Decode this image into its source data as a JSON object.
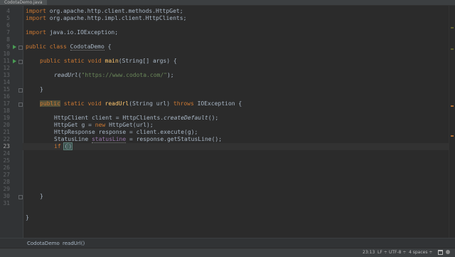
{
  "tab": {
    "title": "CodotaDemo.java"
  },
  "gutter": {
    "line_numbers": [
      "4",
      "5",
      "6",
      "7",
      "8",
      "9",
      "10",
      "11",
      "12",
      "13",
      "14",
      "15",
      "16",
      "17",
      "18",
      "19",
      "20",
      "21",
      "22",
      "23",
      "24",
      "25",
      "26",
      "27",
      "28",
      "29",
      "30",
      "31"
    ],
    "active_line": "23"
  },
  "code": {
    "l4_kw": "import",
    "l4_rest": " org.apache.http.client.methods.HttpGet;",
    "l5_kw": "import",
    "l5_rest": " org.apache.http.impl.client.HttpClients;",
    "l7_kw": "import",
    "l7_rest": " java.io.IOException;",
    "l9_kw": "public class",
    "l9_sp": " ",
    "l9_name": "CodotaDemo",
    "l9_rest": " {",
    "l11_kw": "public static void",
    "l11_sp": " ",
    "l11_fn": "main",
    "l11_rest": "(String[] args) {",
    "l13_call": "readUrl",
    "l13_open": "(",
    "l13_str": "\"https://www.codota.com/\"",
    "l13_close": ");",
    "l15_text": "}",
    "l17_pub": "public",
    "l17_kw": " static void ",
    "l17_fn": "readUrl",
    "l17_args": "(String url) ",
    "l17_throws": "throws",
    "l17_rest": " IOException {",
    "l19_a": "HttpClient client = HttpClients.",
    "l19_b": "createDefault",
    "l19_c": "();",
    "l20_a": "HttpGet g = ",
    "l20_new": "new",
    "l20_c": " HttpGet(url);",
    "l21_text": "HttpResponse response = client.execute(g);",
    "l22_a": "StatusLine ",
    "l22_var": "statusLine",
    "l22_c": " = response.getStatusLine();",
    "l23_kw": "if",
    "l23_sp": " ",
    "l23_paren": "(",
    "l23_close": ")",
    "l27_text": "}",
    "l30_text": "}"
  },
  "breadcrumb": {
    "class_name": "CodotaDemo",
    "separator": "›",
    "method_name": "readUrl()"
  },
  "status": {
    "position": "23:13",
    "line_ending": "LF",
    "line_ending_arrow": "÷",
    "encoding": "UTF-8",
    "encoding_arrow": "÷",
    "indent": "4 spaces",
    "indent_arrow": "÷"
  },
  "colors": {
    "keyword": "#cc7832",
    "function": "#ffc66d",
    "string": "#6a8759",
    "text": "#a9b7c6",
    "background": "#2b2b2b"
  }
}
